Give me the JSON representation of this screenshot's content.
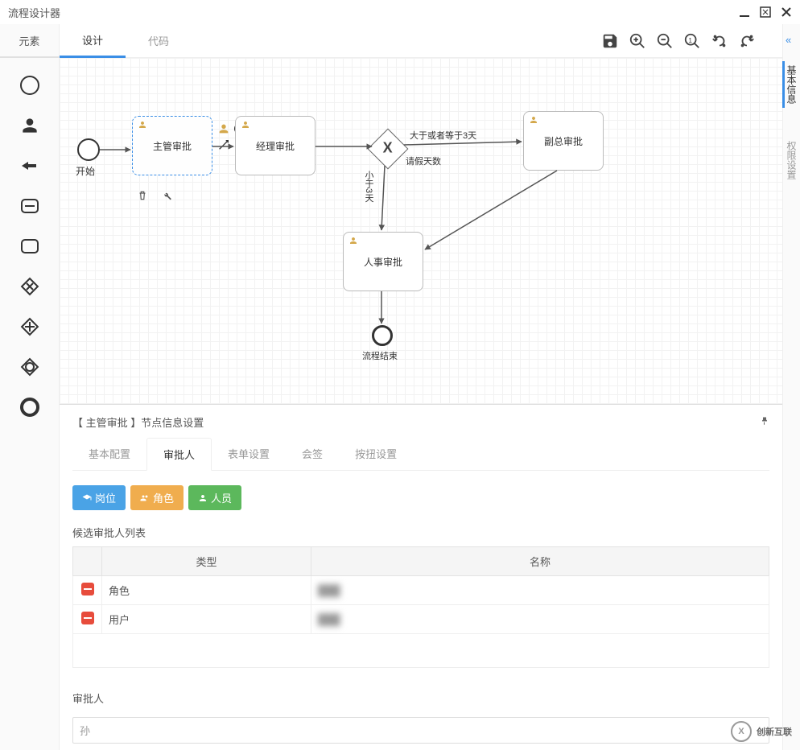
{
  "window": {
    "title": "流程设计器"
  },
  "leftPalette": {
    "header": "元素"
  },
  "topTabs": {
    "design": "设计",
    "code": "代码"
  },
  "rightRail": {
    "tab1": "基本信息",
    "tab2": "权限设置"
  },
  "canvas": {
    "startLabel": "开始",
    "node_supervisor": "主管审批",
    "node_manager": "经理审批",
    "node_vp": "副总审批",
    "node_hr": "人事审批",
    "gateway_label": "请假天数",
    "edge_ge3": "大于或者等于3天",
    "edge_lt3": "小于3天",
    "endLabel": "流程结束"
  },
  "bottomPanel": {
    "title": "【 主管审批 】节点信息设置",
    "tabs": {
      "basic": "基本配置",
      "approver": "审批人",
      "form": "表单设置",
      "countersign": "会签",
      "button": "按扭设置"
    },
    "buttons": {
      "post": "岗位",
      "role": "角色",
      "person": "人员"
    },
    "listLabel": "候选审批人列表",
    "columns": {
      "type": "类型",
      "name": "名称"
    },
    "rows": [
      {
        "type": "角色",
        "name": "███"
      },
      {
        "type": "用户",
        "name": "███"
      }
    ],
    "approverLabel": "审批人",
    "approverInputValue": "孙"
  },
  "watermark": {
    "brand": "创新互联"
  }
}
